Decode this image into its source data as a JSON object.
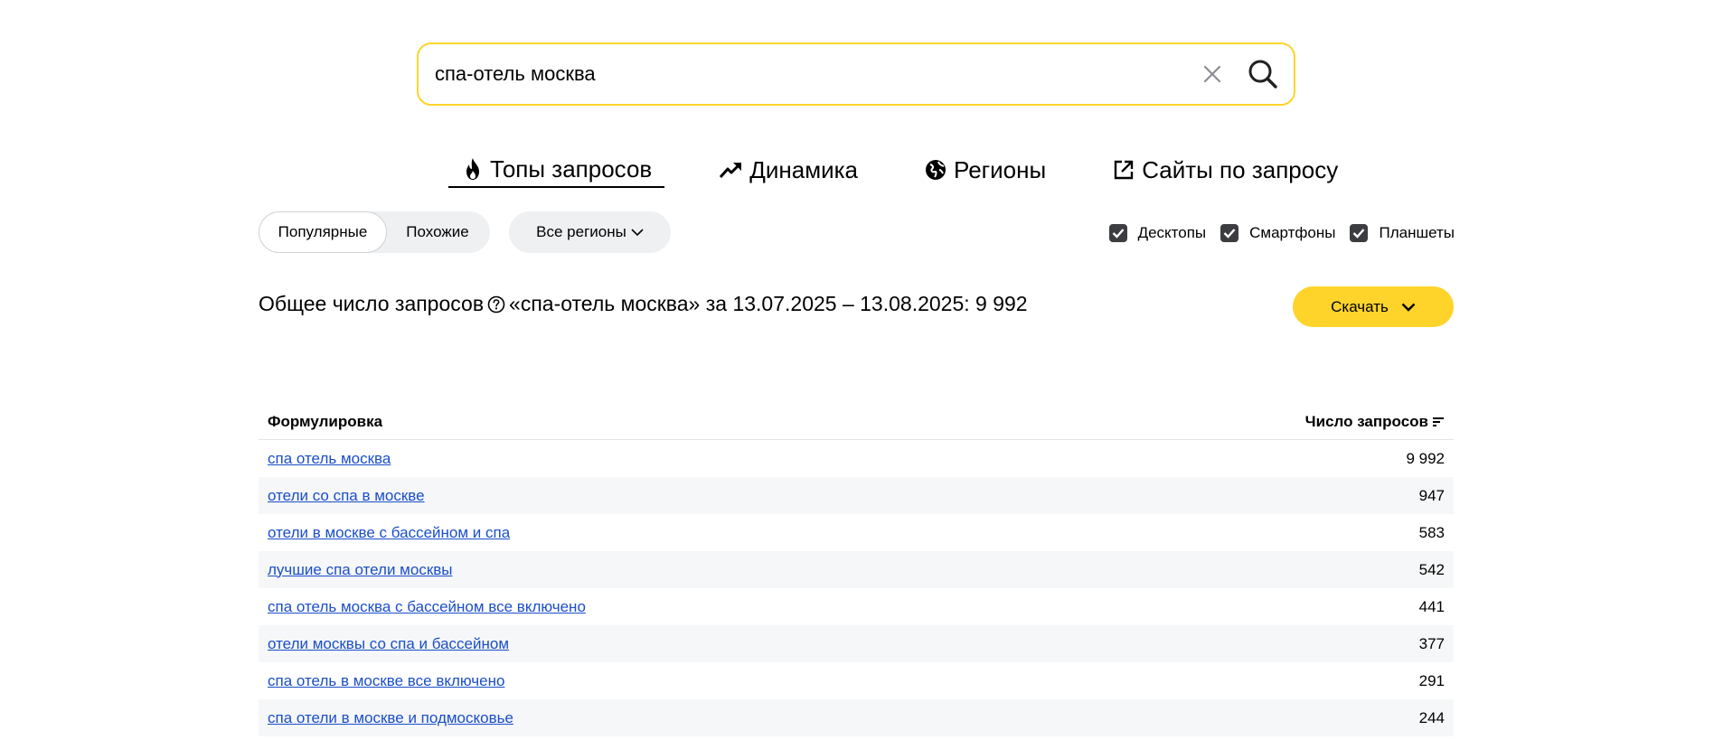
{
  "search": {
    "value": "спа-отель москва"
  },
  "icons": {
    "clear": "close-icon",
    "search": "search-icon",
    "tab_top": "fire-icon",
    "tab_dynamics": "trend-up-icon",
    "tab_regions": "globe-icon",
    "tab_sites": "external-link-icon",
    "help": "question-circle-icon",
    "dropdown": "chevron-down-icon",
    "sort": "sort-icon",
    "checkbox": "check-icon"
  },
  "tabs": [
    {
      "label": "Топы запросов",
      "active": true
    },
    {
      "label": "Динамика",
      "active": false
    },
    {
      "label": "Регионы",
      "active": false
    },
    {
      "label": "Сайты по запросу",
      "active": false
    }
  ],
  "filters": {
    "popular": "Популярные",
    "similar": "Похожие",
    "region": "Все регионы"
  },
  "devices": [
    {
      "label": "Десктопы",
      "checked": true
    },
    {
      "label": "Смартфоны",
      "checked": true
    },
    {
      "label": "Планшеты",
      "checked": true
    }
  ],
  "summary": {
    "prefix": "Общее число запросов",
    "suffix": "«спа-отель москва» за 13.07.2025 – 13.08.2025: 9 992"
  },
  "download": {
    "label": "Скачать"
  },
  "table": {
    "col_phrase": "Формулировка",
    "col_count": "Число запросов",
    "rows": [
      {
        "phrase": "спа отель москва",
        "count": "9 992"
      },
      {
        "phrase": "отели со спа в москве",
        "count": "947"
      },
      {
        "phrase": "отели в москве с бассейном и спа",
        "count": "583"
      },
      {
        "phrase": "лучшие спа отели москвы",
        "count": "542"
      },
      {
        "phrase": "спа отель москва с бассейном все включено",
        "count": "441"
      },
      {
        "phrase": "отели москвы со спа и бассейном",
        "count": "377"
      },
      {
        "phrase": "спа отель в москве все включено",
        "count": "291"
      },
      {
        "phrase": "спа отели в москве и подмосковье",
        "count": "244"
      }
    ]
  },
  "colors": {
    "accent": "#fed42b",
    "link": "#1a4ec9",
    "checkbox": "#3b3d40"
  }
}
